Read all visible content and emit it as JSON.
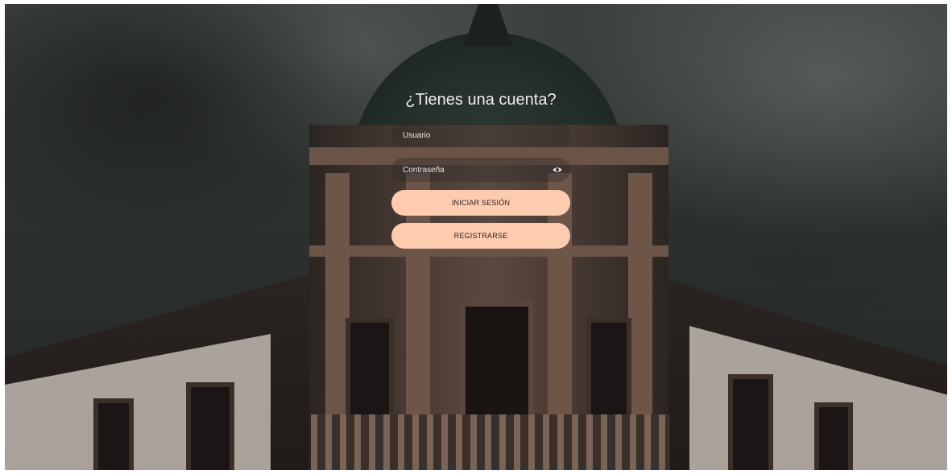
{
  "login": {
    "title": "¿Tienes una cuenta?",
    "username_placeholder": "Usuario",
    "password_placeholder": "Contraseña",
    "login_button": "INICIAR SESIÓN",
    "register_button": "REGISTRARSE",
    "show_password_icon": "eye-icon"
  },
  "colors": {
    "button": "#fdcbb0",
    "button_text": "#2b221e",
    "title_text": "#f1eeea"
  }
}
